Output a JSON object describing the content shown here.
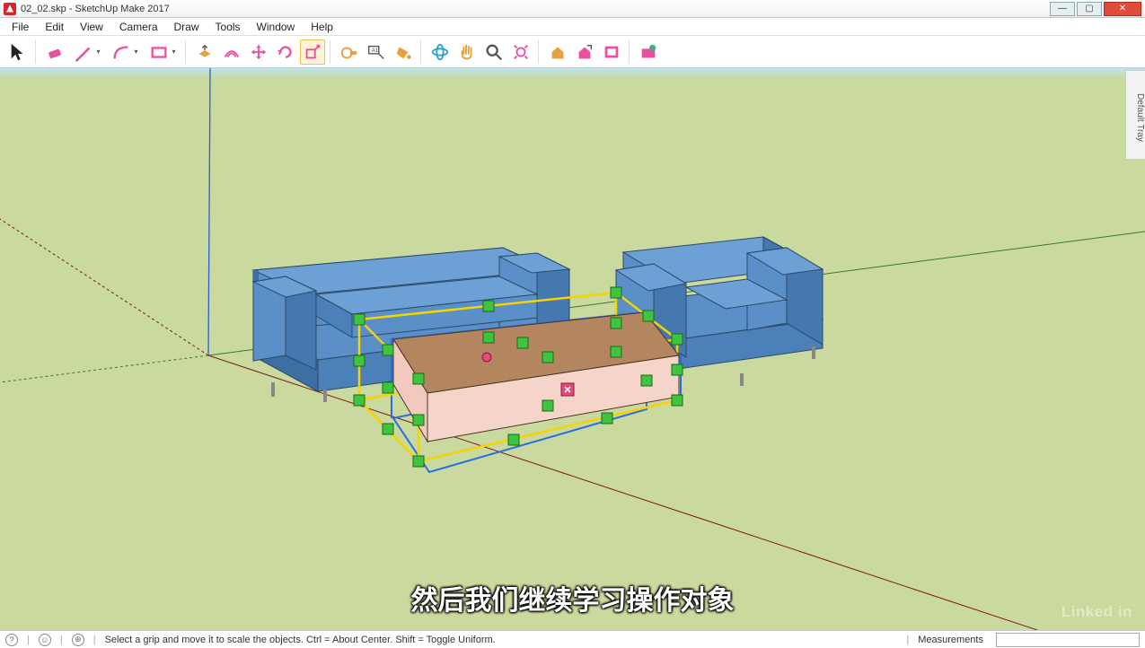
{
  "window": {
    "title": "02_02.skp - SketchUp Make 2017",
    "min": "—",
    "max": "▢",
    "close": "✕"
  },
  "menu": {
    "items": [
      "File",
      "Edit",
      "View",
      "Camera",
      "Draw",
      "Tools",
      "Window",
      "Help"
    ]
  },
  "toolbar": {
    "tools": [
      {
        "name": "select-tool",
        "color": "#222",
        "glyph": "cursor"
      },
      {
        "name": "eraser-tool",
        "color": "#ec4fa0",
        "glyph": "eraser",
        "dd": false,
        "sep_before": true
      },
      {
        "name": "line-tool",
        "color": "#ec4fa0",
        "glyph": "pencil",
        "dd": true
      },
      {
        "name": "arc-tool",
        "color": "#ec4fa0",
        "glyph": "arc",
        "dd": true
      },
      {
        "name": "rectangle-tool",
        "color": "#ec4fa0",
        "glyph": "rect",
        "dd": true
      },
      {
        "name": "pushpull-tool",
        "color": "#e9a03c",
        "glyph": "pushpull",
        "sep_before": true
      },
      {
        "name": "offset-tool",
        "color": "#ec4fa0",
        "glyph": "offset"
      },
      {
        "name": "move-tool",
        "color": "#ec4fa0",
        "glyph": "move"
      },
      {
        "name": "rotate-tool",
        "color": "#ec4fa0",
        "glyph": "rotate"
      },
      {
        "name": "scale-tool",
        "color": "#ec4fa0",
        "glyph": "scale",
        "active": true
      },
      {
        "name": "tapemeasure-tool",
        "color": "#e9a03c",
        "glyph": "tape",
        "sep_before": true
      },
      {
        "name": "text-tool",
        "color": "#555",
        "glyph": "text"
      },
      {
        "name": "paintbucket-tool",
        "color": "#e9a03c",
        "glyph": "bucket"
      },
      {
        "name": "orbit-tool",
        "color": "#2a9fd6",
        "glyph": "orbit",
        "sep_before": true
      },
      {
        "name": "pan-tool",
        "color": "#e9a03c",
        "glyph": "pan"
      },
      {
        "name": "zoom-tool",
        "color": "#555",
        "glyph": "zoom"
      },
      {
        "name": "zoomextents-tool",
        "color": "#ec4fa0",
        "glyph": "zoomext"
      },
      {
        "name": "warehouse-tool",
        "color": "#e9a03c",
        "glyph": "wh",
        "sep_before": true
      },
      {
        "name": "extwarehouse-tool",
        "color": "#ec4fa0",
        "glyph": "wh2"
      },
      {
        "name": "layout-tool",
        "color": "#ec4fa0",
        "glyph": "layout"
      },
      {
        "name": "extensions-tool",
        "color": "#ec4fa0",
        "glyph": "ext",
        "sep_before": true
      }
    ]
  },
  "tray": {
    "label": "Default Tray"
  },
  "status": {
    "hint": "Select a grip and move it to scale the objects. Ctrl = About Center. Shift = Toggle Uniform.",
    "measurements_label": "Measurements"
  },
  "subtitle": "然后我们继续学习操作对象",
  "watermark": "Linked in"
}
